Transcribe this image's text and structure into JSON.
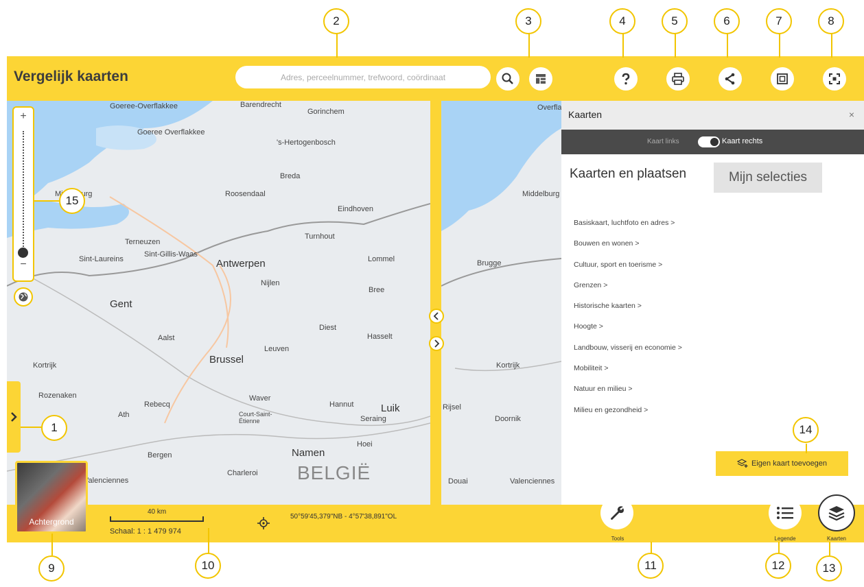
{
  "header": {
    "title": "Vergelijk kaarten",
    "search_placeholder": "Adres, perceelnummer, trefwoord, coördinaat"
  },
  "map_left": {
    "places": [
      "Goeree-Overflakkee",
      "Barendrecht",
      "Gorinchem",
      "Goeree Overflakkee",
      "'s-Hertogenbosch",
      "Breda",
      "Middelburg",
      "Roosendaal",
      "Eindhoven",
      "Terneuzen",
      "Sint-Laureins",
      "Sint-Gillis-Waas",
      "Turnhout",
      "Antwerpen",
      "Lommel",
      "Nijlen",
      "Bree",
      "Gent",
      "Aalst",
      "Diest",
      "Hasselt",
      "Leuven",
      "Brussel",
      "Kortrijk",
      "Rozenaken",
      "Rebecq",
      "Waver",
      "Hannut",
      "Luik",
      "Seraing",
      "Ath",
      "Court-Saint-Étienne",
      "Hoei",
      "Bergen",
      "Namen",
      "Charleroi",
      "Valenciennes",
      "BELGIË"
    ]
  },
  "map_right": {
    "places": [
      "Overflakkee",
      "Middelburg",
      "Brugge",
      "Kortrijk",
      "Rijsel",
      "Doornik",
      "Douai",
      "Valenciennes"
    ]
  },
  "panel": {
    "title": "Kaarten",
    "close": "×",
    "toggle_left": "Kaart links",
    "toggle_right": "Kaart rechts",
    "tab_active": "Kaarten en plaatsen",
    "tab_selections": "Mijn selecties",
    "categories": [
      "Basiskaart, luchtfoto en adres >",
      "Bouwen en wonen >",
      "Cultuur, sport en toerisme >",
      "Grenzen >",
      "Historische kaarten >",
      "Hoogte >",
      "Landbouw, visserij en economie >",
      "Mobiliteit >",
      "Natuur en milieu >",
      "Milieu en gezondheid >"
    ],
    "add_map": "Eigen kaart toevoegen"
  },
  "footer": {
    "background_label": "Achtergrond",
    "scale_km": "40 km",
    "scale": "Schaal: 1 : 1 479 974",
    "coordinates": "50°59'45,379\"NB - 4°57'38,891\"OL",
    "tools": "Tools",
    "legend": "Legende",
    "maps": "Kaarten"
  },
  "callouts": [
    "1",
    "2",
    "3",
    "4",
    "5",
    "6",
    "7",
    "8",
    "9",
    "10",
    "11",
    "12",
    "13",
    "14",
    "15"
  ],
  "colors": {
    "accent": "#fcd535",
    "panel_header": "#ececec",
    "toggle_bar": "#4a4a4a",
    "water": "#a9d3f5",
    "land": "#e9ecef"
  }
}
